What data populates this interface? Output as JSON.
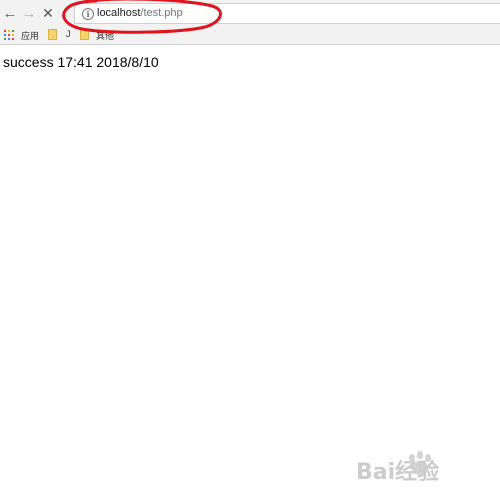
{
  "browser": {
    "address_bar": {
      "host": "localhost",
      "path": "/test.php",
      "info_glyph": "i"
    },
    "nav": {
      "back_icon": "arrow-left-icon",
      "forward_icon": "arrow-right-icon",
      "stop_icon": "close-icon"
    },
    "bookmarks": [
      {
        "label": "应用",
        "icon": "apps-grid-icon"
      },
      {
        "label": "J",
        "icon": "folder-icon"
      },
      {
        "label": "其他",
        "icon": "folder-icon"
      }
    ]
  },
  "page": {
    "text": "success 17:41 2018/8/10"
  },
  "annotation": {
    "color": "#e0141e"
  },
  "watermark": {
    "text": "Bai经验"
  },
  "colors": {
    "apps_grid": [
      "#e94235",
      "#fbbc05",
      "#34a853",
      "#4285f4",
      "#e94235",
      "#fbbc05",
      "#34a853",
      "#4285f4",
      "#e94235"
    ]
  }
}
